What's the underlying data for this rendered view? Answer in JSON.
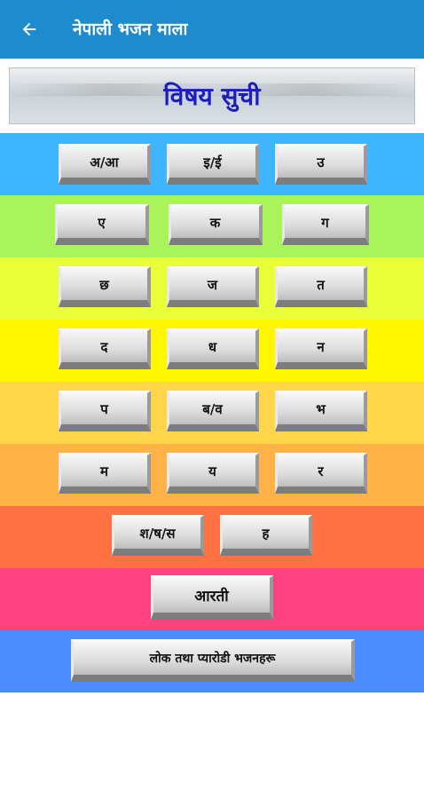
{
  "appbar": {
    "title": "नेपाली भजन माला",
    "back_icon": "arrow-left-icon"
  },
  "banner": {
    "title": "विषय सुची"
  },
  "rows": [
    {
      "color": "#3fb5ff",
      "buttons": [
        "अ/आ",
        "इ/ई",
        "उ"
      ]
    },
    {
      "color": "#a9f35b",
      "buttons": [
        "ए",
        "क",
        "ग"
      ]
    },
    {
      "color": "#e8ff3a",
      "buttons": [
        "छ",
        "ज",
        "त"
      ]
    },
    {
      "color": "#fff600",
      "buttons": [
        "द",
        "ध",
        "न"
      ]
    },
    {
      "color": "#ffd54a",
      "buttons": [
        "प",
        "ब/व",
        "भ"
      ]
    },
    {
      "color": "#ffb347",
      "buttons": [
        "म",
        "य",
        "र"
      ]
    },
    {
      "color": "#ff7043",
      "buttons": [
        "श/ष/स",
        "ह"
      ]
    },
    {
      "color": "#ff4081",
      "buttons": [
        "आरती"
      ]
    },
    {
      "color": "#4a8cff",
      "buttons": [
        "लोक तथा प्यारोडी भजनहरू"
      ]
    }
  ]
}
